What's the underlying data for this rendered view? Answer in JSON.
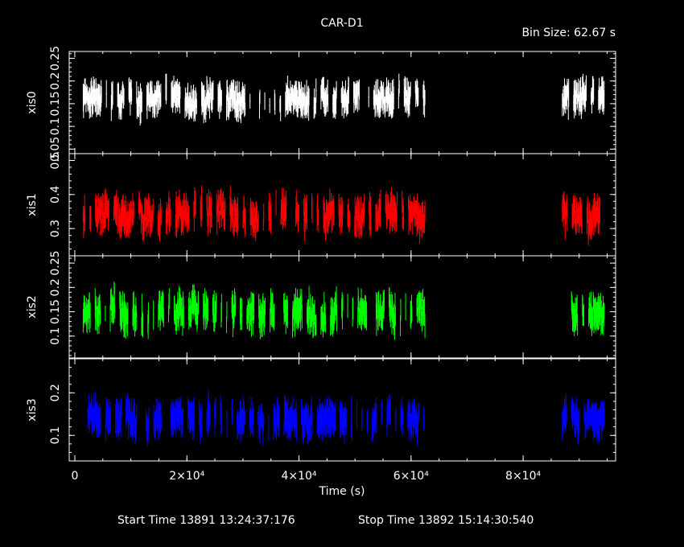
{
  "title": "CAR-D1",
  "bin_size": "Bin Size: 62.67 s",
  "xlabel": "Time (s)",
  "start_time": "Start Time 13891 13:24:37:176",
  "stop_time": "Stop Time 13892 15:14:30:540",
  "chart_data": {
    "type": "line",
    "x_axis": {
      "label": "Time (s)",
      "range": [
        -1000,
        96500
      ],
      "major_ticks": [
        0,
        20000,
        40000,
        60000,
        80000
      ],
      "tick_labels": [
        "0",
        "2×10⁴",
        "4×10⁴",
        "6×10⁴",
        "8×10⁴"
      ]
    },
    "data_segments": [
      [
        1500,
        62500
      ],
      [
        87000,
        94500
      ]
    ],
    "series": [
      {
        "name": "xis0",
        "color": "#ffffff",
        "ylim": [
          0.04,
          0.265
        ],
        "ticks": [
          0.05,
          0.1,
          0.15,
          0.2,
          0.25
        ],
        "tick_labels": [
          "0.05",
          "0.1",
          "0.15",
          "0.2",
          "0.25"
        ],
        "mean": 0.16,
        "spread": 0.025,
        "err": 0.022
      },
      {
        "name": "xis1",
        "color": "#ff0000",
        "ylim": [
          0.22,
          0.52
        ],
        "ticks": [
          0.3,
          0.4,
          0.5
        ],
        "tick_labels": [
          "0.3",
          "0.4",
          "0.5"
        ],
        "mean": 0.34,
        "spread": 0.04,
        "err": 0.03
      },
      {
        "name": "xis2",
        "color": "#00ff00",
        "ylim": [
          0.055,
          0.265
        ],
        "ticks": [
          0.1,
          0.15,
          0.2,
          0.25
        ],
        "tick_labels": [
          "0.1",
          "0.15",
          "0.2",
          "0.25"
        ],
        "mean": 0.15,
        "spread": 0.028,
        "err": 0.022
      },
      {
        "name": "xis3",
        "color": "#0000ff",
        "ylim": [
          0.04,
          0.28
        ],
        "ticks": [
          0.1,
          0.2
        ],
        "tick_labels": [
          "0.1",
          "0.2"
        ],
        "mean": 0.14,
        "spread": 0.028,
        "err": 0.025
      }
    ]
  }
}
